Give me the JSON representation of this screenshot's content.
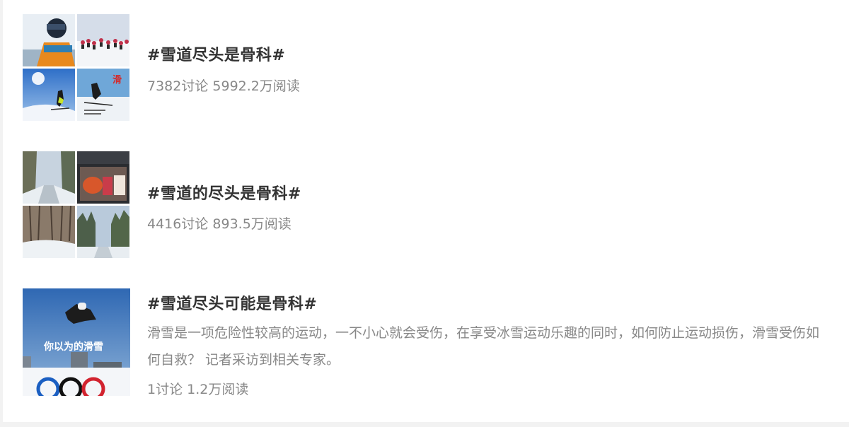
{
  "topics": [
    {
      "title": "#雪道尽头是骨科#",
      "stats": "7382讨论 5992.2万阅读",
      "thumb_icon": "ski-collage-image"
    },
    {
      "title": "#雪道的尽头是骨科#",
      "stats": "4416讨论 893.5万阅读",
      "thumb_icon": "snowy-road-collage-image"
    },
    {
      "title": "#雪道尽头可能是骨科#",
      "description": "滑雪是一项危险性较高的运动，一不小心就会受伤，在享受冰雪运动乐趣的同时，如何防止运动损伤，滑雪受伤如何自救？ 记者采访到相关专家。",
      "stats": "1讨论 1.2万阅读",
      "thumb_caption": "你以为的滑雪",
      "thumb_icon": "olympic-ski-jump-image"
    }
  ]
}
